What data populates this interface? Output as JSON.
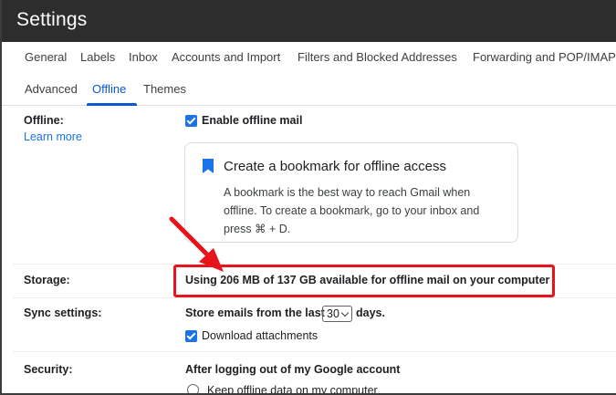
{
  "header": {
    "title": "Settings"
  },
  "tabs_row1": [
    "General",
    "Labels",
    "Inbox",
    "Accounts and Import",
    "Filters and Blocked Addresses",
    "Forwarding and POP/IMAP"
  ],
  "tabs_row2": [
    "Advanced",
    "Offline",
    "Themes"
  ],
  "offline": {
    "label": "Offline:",
    "learn_more": "Learn more",
    "enable_label": "Enable offline mail",
    "enable_checked": true,
    "card": {
      "title": "Create a bookmark for offline access",
      "line1": "A bookmark is the best way to reach Gmail when",
      "line2": "offline. To create a bookmark, go to your inbox and",
      "line3": "press ⌘ + D."
    }
  },
  "storage": {
    "label": "Storage:",
    "text": "Using 206 MB of 137 GB available for offline mail on your computer"
  },
  "sync": {
    "label": "Sync settings:",
    "prefix": "Store emails from the last",
    "days_value": "30",
    "suffix": "days.",
    "download_label": "Download attachments",
    "download_checked": true
  },
  "security": {
    "label": "Security:",
    "heading": "After logging out of my Google account",
    "option1": "Keep offline data on my computer"
  },
  "colors": {
    "accent": "#1a73e8",
    "highlight": "#e8141c",
    "titlebar": "#2d2d2d"
  }
}
